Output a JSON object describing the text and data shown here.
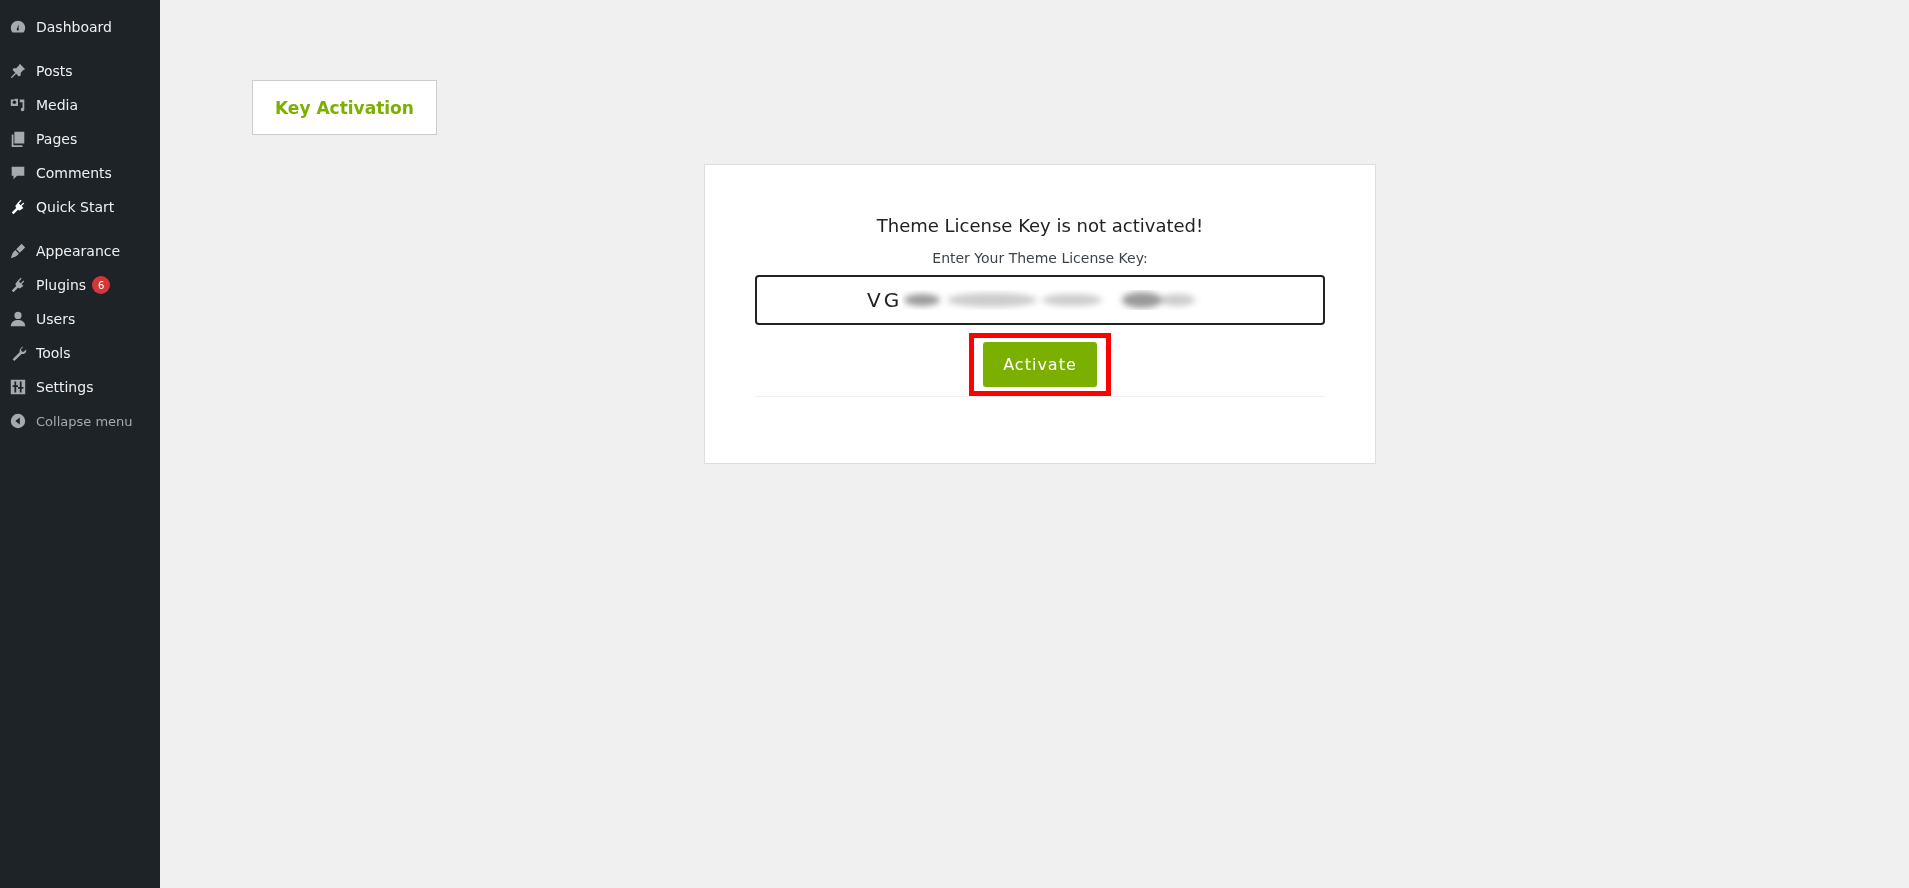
{
  "sidebar": {
    "groups": [
      [
        {
          "label": "Dashboard",
          "kind": "gauge"
        }
      ],
      [
        {
          "label": "Posts",
          "kind": "pin"
        },
        {
          "label": "Media",
          "kind": "media"
        },
        {
          "label": "Pages",
          "kind": "pages"
        },
        {
          "label": "Comments",
          "kind": "comment"
        },
        {
          "label": "Quick Start",
          "kind": "plug",
          "active": true
        }
      ],
      [
        {
          "label": "Appearance",
          "kind": "brush"
        },
        {
          "label": "Plugins",
          "kind": "plug",
          "badge": "6"
        },
        {
          "label": "Users",
          "kind": "user"
        },
        {
          "label": "Tools",
          "kind": "wrench"
        },
        {
          "label": "Settings",
          "kind": "sliders"
        }
      ]
    ],
    "collapse": "Collapse menu"
  },
  "tab": {
    "label": "Key Activation"
  },
  "card": {
    "title": "Theme License Key is not activated!",
    "label": "Enter Your Theme License Key:",
    "value": "VG",
    "value_blurred": true,
    "button": "Activate",
    "button_highlighted": true
  }
}
